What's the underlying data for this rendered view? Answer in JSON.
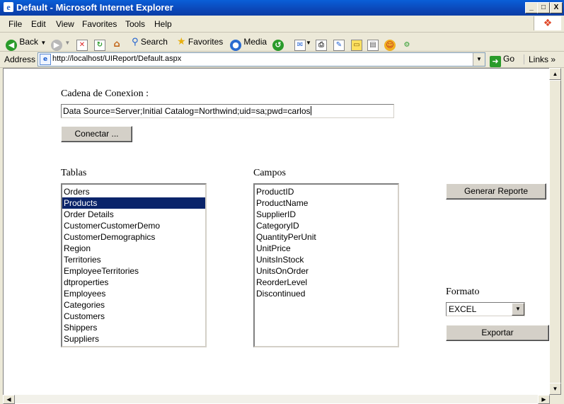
{
  "window": {
    "title": "Default - Microsoft Internet Explorer",
    "minimize": "_",
    "maximize": "□",
    "close": "X"
  },
  "menu": [
    "File",
    "Edit",
    "View",
    "Favorites",
    "Tools",
    "Help"
  ],
  "toolbar": {
    "back": "Back",
    "search": "Search",
    "favorites": "Favorites",
    "media": "Media"
  },
  "address": {
    "label": "Address",
    "url": "http://localhost/UIReport/Default.aspx",
    "go": "Go",
    "links": "Links"
  },
  "page": {
    "connection_label": "Cadena de Conexion :",
    "connection_value": "Data Source=Server;Initial Catalog=Northwind;uid=sa;pwd=carlos",
    "connect_button": "Conectar ...",
    "tables_label": "Tablas",
    "tables": [
      "Orders",
      "Products",
      "Order Details",
      "CustomerCustomerDemo",
      "CustomerDemographics",
      "Region",
      "Territories",
      "EmployeeTerritories",
      "dtproperties",
      "Employees",
      "Categories",
      "Customers",
      "Shippers",
      "Suppliers"
    ],
    "selected_table": "Products",
    "fields_label": "Campos",
    "fields": [
      "ProductID",
      "ProductName",
      "SupplierID",
      "CategoryID",
      "QuantityPerUnit",
      "UnitPrice",
      "UnitsInStock",
      "UnitsOnOrder",
      "ReorderLevel",
      "Discontinued"
    ],
    "generate_button": "Generar Reporte",
    "format_label": "Formato",
    "format_value": "EXCEL",
    "export_button": "Exportar"
  }
}
